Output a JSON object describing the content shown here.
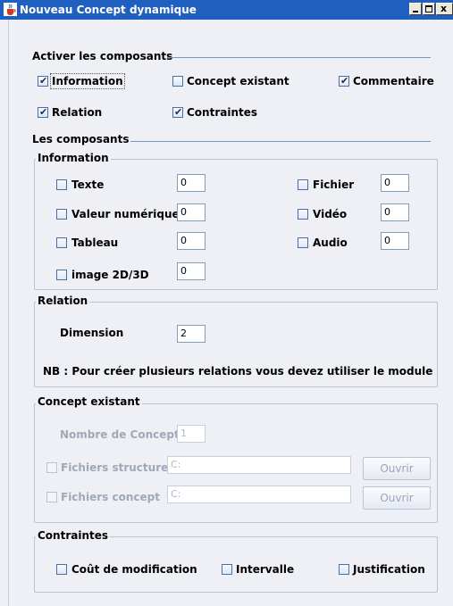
{
  "window": {
    "title": "Nouveau Concept dynamique",
    "title_bar_color": "#1f5fbf"
  },
  "activer": {
    "heading": "Activer les composants",
    "items": [
      {
        "label": "Information",
        "checked": true
      },
      {
        "label": "Concept existant",
        "checked": false
      },
      {
        "label": "Commentaire",
        "checked": true
      },
      {
        "label": "Relation",
        "checked": true
      },
      {
        "label": "Contraintes",
        "checked": true
      }
    ]
  },
  "composants": {
    "heading": "Les composants"
  },
  "information": {
    "legend": "Information",
    "rows": [
      {
        "label": "Texte",
        "value": "0"
      },
      {
        "label": "Valeur numérique",
        "value": "0"
      },
      {
        "label": "Tableau",
        "value": "0"
      },
      {
        "label": "image 2D/3D",
        "value": "0"
      },
      {
        "label": "Fichier",
        "value": "0"
      },
      {
        "label": "Vidéo",
        "value": "0"
      },
      {
        "label": "Audio",
        "value": "0"
      }
    ]
  },
  "relation": {
    "legend": "Relation",
    "dimension_label": "Dimension",
    "dimension_value": "2",
    "note": "NB : Pour créer plusieurs relations vous devez utiliser le module de trac"
  },
  "concept_existant": {
    "legend": "Concept existant",
    "nombre_label": "Nombre de Concept",
    "nombre_value": "1",
    "structure_label": "Fichiers structure",
    "structure_value": "C:",
    "concept_label": "Fichiers concept",
    "concept_value": "C:",
    "open_label": "Ouvrir"
  },
  "contraintes": {
    "legend": "Contraintes",
    "items": [
      {
        "label": "Coût de modification"
      },
      {
        "label": "Intervalle"
      },
      {
        "label": "Justification"
      }
    ]
  }
}
